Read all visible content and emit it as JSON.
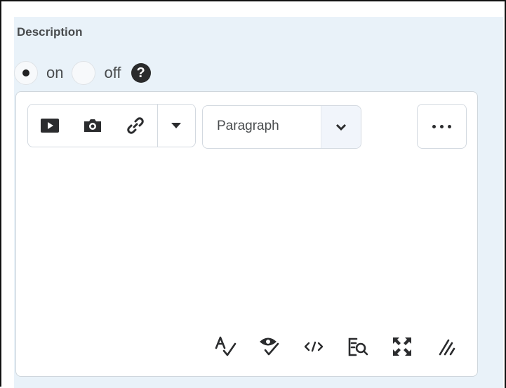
{
  "description": {
    "label": "Description",
    "radio": {
      "on_label": "on",
      "off_label": "off",
      "selected": "on"
    }
  },
  "editor": {
    "toolbar": {
      "icons": [
        "video-icon",
        "camera-icon",
        "link-icon",
        "caret-down-icon"
      ],
      "format_select": {
        "value": "Paragraph"
      },
      "more_icon": "more-horizontal-icon"
    },
    "content": "",
    "status_bar_icons": [
      "spellcheck-icon",
      "accessibility-icon",
      "source-code-icon",
      "preview-icon",
      "fullscreen-icon",
      "resize-icon"
    ]
  },
  "colors": {
    "panel_bg": "#e9f2f9",
    "border": "#d3d9e0",
    "text": "#494c4e",
    "icon": "#2b2c2e"
  }
}
